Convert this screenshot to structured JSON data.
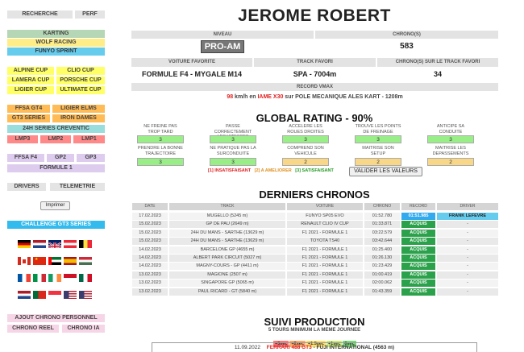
{
  "sidebar": {
    "recherche": "RECHERCHE",
    "perf": "PERF",
    "karting": "KARTING",
    "wolf": "WOLF RACING",
    "funyo": "FUNYO SPRINT",
    "alpine": "ALPINE CUP",
    "clio": "CLIO CUP",
    "lamera": "LAMERA CUP",
    "porsche": "PORSCHE CUP",
    "ligier_cup": "LIGIER CUP",
    "ultimate": "ULTIMATE CUP",
    "ffsa_gt4": "FFSA GT4",
    "ligier_elms": "LIGIER ELMS",
    "gt3": "GT3 SERIES",
    "iron": "IRON DAMES",
    "h24": "24H SERIES CREVENTIC",
    "lmp3": "LMP3",
    "lmp2": "LMP2",
    "lmp1": "LMP1",
    "ffsa_f4": "FFSA F4",
    "gp2": "GP2",
    "gp3": "GP3",
    "f1": "FORMULE 1",
    "drivers": "DRIVERS",
    "telemetrie": "TELEMETRIE",
    "imprimer": "Imprimer",
    "challenge": "CHALLENGE GT3 SERIES",
    "ajout": "AJOUT CHRONO PERSONNEL",
    "chrono_reel": "CHRONO REEL",
    "chrono_ia": "CHRONO IA",
    "flags": [
      "germany",
      "netherlands",
      "uk",
      "austria",
      "belgium",
      "canada",
      "china",
      "uae",
      "spain",
      "hungary",
      "france",
      "italy",
      "ireland",
      "monaco",
      "mexico",
      "netherlands-2",
      "portugal",
      "singapore",
      "usa",
      "usa-2"
    ]
  },
  "page_title": "JEROME ROBERT",
  "profile": {
    "niveau_label": "NIVEAU",
    "niveau_badge": "PRO-AM",
    "chronos_label": "CHRONO(S)",
    "chronos_value": "583",
    "voiture_label": "VOITURE FAVORITE",
    "voiture_value": "FORMULE F4 - MYGALE M14",
    "track_label": "TRACK FAVORI",
    "track_value": "SPA - 7004m",
    "track_chronos_label": "CHRONO(S) SUR LE TRACK FAVORI",
    "track_chronos_value": "34",
    "vmax_label": "RECORD VMAX",
    "vmax_speed": "98",
    "vmax_unit": " km/h en ",
    "vmax_kart": "IAME X30",
    "vmax_rest": " sur POLE MECANIQUE ALES KART - 1208m"
  },
  "global_rating": {
    "title": "GLOBAL RATING - 90%",
    "items": [
      {
        "label": "NE FREINE PAS TROP TARD",
        "value": "3",
        "color": "#99ee88"
      },
      {
        "label": "PASSE CORRECTEMENT LES VITESSES",
        "value": "3",
        "color": "#99ee88"
      },
      {
        "label": "ACCELERE LES ROUES DROITES",
        "value": "3",
        "color": "#99ee88"
      },
      {
        "label": "TROUVE LES POINTS DE FREINAGE",
        "value": "3",
        "color": "#99ee88"
      },
      {
        "label": "ANTICIPE SA CONDUITE",
        "value": "3",
        "color": "#99ee88"
      },
      {
        "label": "PRENDRE LA BONNE TRAJECTOIRE",
        "value": "3",
        "color": "#99ee88"
      },
      {
        "label": "NE PRATIQUE PAS LA SURCONDUITE",
        "value": "3",
        "color": "#99ee88"
      },
      {
        "label": "COMPREND SON VEHICULE",
        "value": "2",
        "color": "#f8d888"
      },
      {
        "label": "MAITRISE SON SETUP",
        "value": "2",
        "color": "#f8d888"
      },
      {
        "label": "MAITRISE LES DEPASSEMENTS",
        "value": "2",
        "color": "#f8d888"
      }
    ],
    "legend1": "[1] INSATISFAISANT",
    "legend2": "[2] A AMELIORER",
    "legend3": "[3] SATISFAISANT",
    "valider": "VALIDER LES VALEURS"
  },
  "chronos": {
    "title": "DERNIERS CHRONOS",
    "headers": [
      "DATE",
      "TRACK",
      "VOITURE",
      "CHRONO",
      "RECORD",
      "DRIVER"
    ],
    "rows": [
      [
        "17.02.2023",
        "MUGELLO (5245 m)",
        "FUNYO SP05 EVO",
        "01:52.780",
        "01:51.985",
        "FRANK LEFEVRE"
      ],
      [
        "15.02.2023",
        "GP DE PAU (2649 m)",
        "RENAULT CLIO IV CUP",
        "01:33.871",
        "ACQUIS",
        "-"
      ],
      [
        "15.02.2023",
        "24H DU MANS - SARTHE (13629 m)",
        "F1 2021 - FORMULE 1",
        "03:22.579",
        "ACQUIS",
        "-"
      ],
      [
        "15.02.2023",
        "24H DU MANS - SARTHE (13629 m)",
        "TOYOTA TS40",
        "03:42.644",
        "ACQUIS",
        "-"
      ],
      [
        "14.02.2023",
        "BARCELONE GP (4655 m)",
        "F1 2021 - FORMULE 1",
        "01:25.400",
        "ACQUIS",
        "-"
      ],
      [
        "14.02.2023",
        "ALBERT PARK CIRCUIT (5027 m)",
        "F1 2021 - FORMULE 1",
        "01:26.130",
        "ACQUIS",
        "-"
      ],
      [
        "14.02.2023",
        "MAGNY-COURS - GP (4411 m)",
        "F1 2021 - FORMULE 1",
        "01:23.429",
        "ACQUIS",
        "-"
      ],
      [
        "13.02.2023",
        "MAGIONE (2507 m)",
        "F1 2021 - FORMULE 1",
        "01:00.419",
        "ACQUIS",
        "-"
      ],
      [
        "13.02.2023",
        "SINGAPORE GP (5065 m)",
        "F1 2021 - FORMULE 1",
        "02:00.062",
        "ACQUIS",
        "-"
      ],
      [
        "13.02.2023",
        "PAUL RICARD - GT (5840 m)",
        "F1 2021 - FORMULE 1",
        "01:43.359",
        "ACQUIS",
        "-"
      ]
    ]
  },
  "suivi": {
    "title": "SUIVI PRODUCTION",
    "subtitle": "5 TOURS MINIMUM LA MEME JOURNEE",
    "legend": [
      "+3sec",
      "+2sec",
      "+1.5sec",
      "+1sec",
      "0sec"
    ],
    "row_date": "11.09.2022",
    "row_car": "FERRARI 488 GT3",
    "row_track": " - FUJI INTERNATIONAL (4563 m)"
  }
}
